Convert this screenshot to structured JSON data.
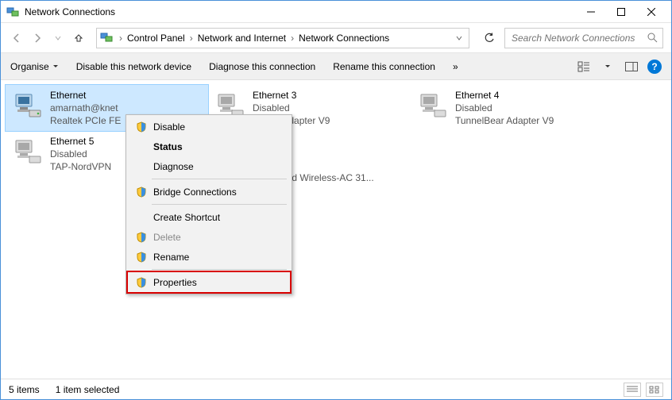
{
  "window": {
    "title": "Network Connections"
  },
  "breadcrumbs": {
    "c0": "Control Panel",
    "c1": "Network and Internet",
    "c2": "Network Connections"
  },
  "search": {
    "placeholder": "Search Network Connections"
  },
  "toolbar": {
    "organise": "Organise",
    "disable": "Disable this network device",
    "diagnose": "Diagnose this connection",
    "rename": "Rename this connection",
    "more": "»"
  },
  "connections": {
    "ethernet": {
      "name": "Ethernet",
      "status": "amarnath@knet",
      "device": "Realtek PCIe FE"
    },
    "ethernet3": {
      "name": "Ethernet 3",
      "status": "Disabled",
      "device": "ndows Adapter V9"
    },
    "ethernet4": {
      "name": "Ethernet 4",
      "status": "Disabled",
      "device": "TunnelBear Adapter V9"
    },
    "ethernet5": {
      "name": "Ethernet 5",
      "status": "Disabled",
      "device": "TAP-NordVPN"
    },
    "wifi_device": "Dual Band Wireless-AC 31..."
  },
  "ctx": {
    "disable": "Disable",
    "status": "Status",
    "diagnose": "Diagnose",
    "bridge": "Bridge Connections",
    "shortcut": "Create Shortcut",
    "delete": "Delete",
    "rename": "Rename",
    "properties": "Properties"
  },
  "statusbar": {
    "count": "5 items",
    "selected": "1 item selected"
  }
}
